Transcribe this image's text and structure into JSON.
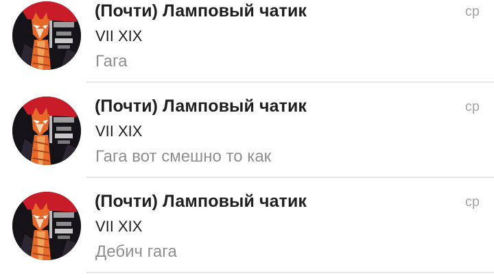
{
  "chats": [
    {
      "title": "(Почти) Ламповый чатик",
      "sender": "VII XIX",
      "message": "Гага",
      "time": "ср",
      "avatar_icon": "fox-in-window-avatar"
    },
    {
      "title": "(Почти) Ламповый чатик",
      "sender": "VII XIX",
      "message": "Гага вот смешно то как",
      "time": "ср",
      "avatar_icon": "fox-in-window-avatar"
    },
    {
      "title": "(Почти) Ламповый чатик",
      "sender": "VII XIX",
      "message": "Дебич гага",
      "time": "ср",
      "avatar_icon": "fox-in-window-avatar"
    }
  ],
  "colors": {
    "title": "#1f1f1f",
    "message": "#8e8e8e",
    "time": "#a5a5a5",
    "divider": "#e6e6e6",
    "avatar_red": "#c81d28",
    "avatar_orange": "#e8682a",
    "avatar_dark": "#161318"
  }
}
